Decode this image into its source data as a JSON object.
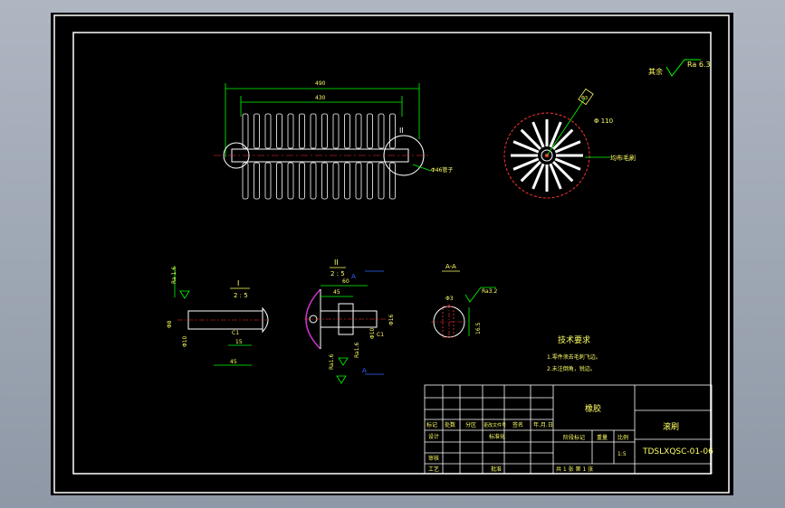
{
  "roughness": {
    "label": "其余",
    "value": "Ra 6.3"
  },
  "main_view": {
    "dim_total": "490",
    "dim_inner": "430",
    "detail_ref": "II",
    "note": "Φ46管子"
  },
  "end_view": {
    "dim_dia": "Φ 110",
    "dim_box": "Φ3",
    "note": "均布毛刷"
  },
  "detail_i": {
    "title": "I",
    "scale": "2 : 5",
    "rough_a": "Ra 1.6",
    "dim_d1": "Φ8",
    "dim_d2": "Φ10",
    "dim_c": "C1",
    "dim_l1": "15",
    "dim_l2": "45"
  },
  "detail_ii": {
    "title": "II",
    "scale": "2 : 5",
    "dim_top": "60",
    "dim_mid": "45",
    "dim_d1": "Φ16",
    "dim_d2": "Φ10",
    "dim_c": "C1",
    "rough_a": "Ra1.6",
    "rough_b": "Ra1.6",
    "marker_a": "A"
  },
  "section_aa": {
    "title": "A-A",
    "dim_angle": "Φ3",
    "rough": "Ra3.2",
    "dim_h": "16.5"
  },
  "tech_req": {
    "title": "技术要求",
    "items": [
      "1.零件须去毛刺飞边。",
      "2.未注倒角，锐边。"
    ]
  },
  "title_block": {
    "headers": [
      "标记",
      "处数",
      "分区",
      "更改文件号",
      "签名",
      "年.月.日"
    ],
    "rows": [
      "设计",
      "标准化",
      "审核",
      "工艺",
      "批准"
    ],
    "material": "橡胶",
    "stage_header": "阶段标记",
    "weight_header": "重量",
    "ratio_header": "比例",
    "scale": "1:5",
    "sheet_info": "共  1  张    第  1  张",
    "part_name": "滚刷",
    "drawing_no": "TDSLXQSC-01-06"
  }
}
